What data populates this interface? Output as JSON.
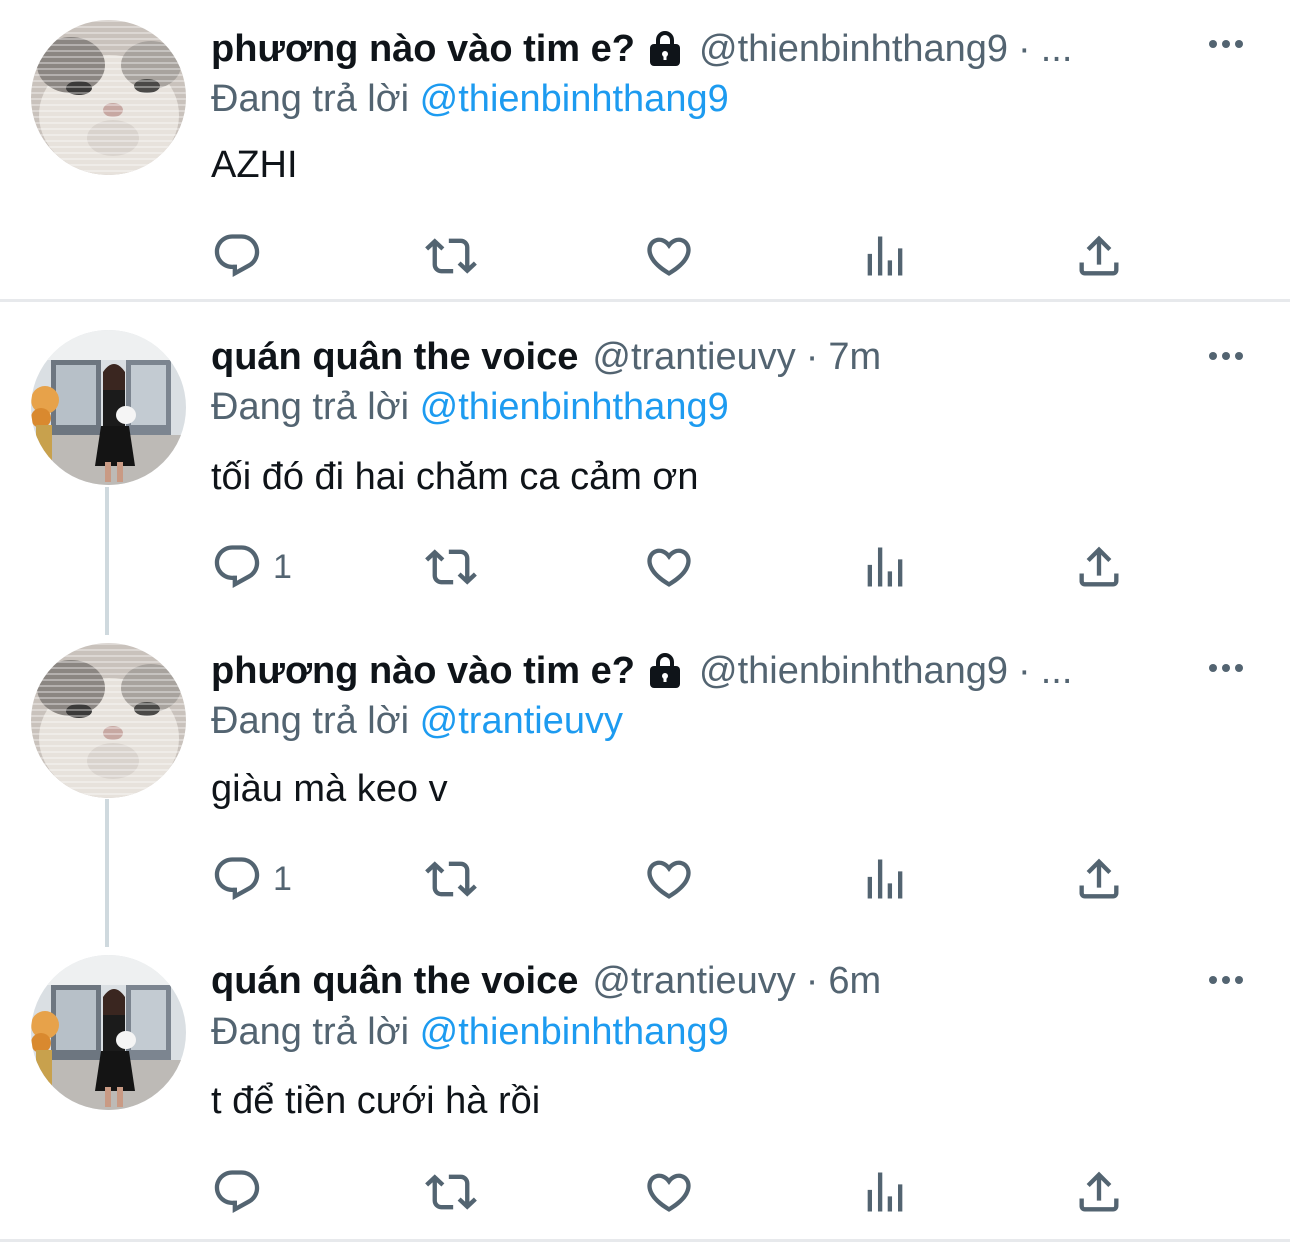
{
  "tweets": [
    {
      "name": "phương nào vào tim e?",
      "locked": true,
      "handle": "@thienbinhthang9",
      "separator": "·",
      "time": "...",
      "reply_prefix": "Đang trả lời",
      "reply_to": "@thienbinhthang9",
      "text": "AZHI",
      "reply_count": "",
      "avatar": "cat-avatar"
    },
    {
      "name": "quán quân the voice",
      "locked": false,
      "handle": "@trantieuvy",
      "separator": "·",
      "time": "7m",
      "reply_prefix": "Đang trả lời",
      "reply_to": "@thienbinhthang9",
      "text": "tối đó đi hai chăm ca cảm ơn",
      "reply_count": "1",
      "avatar": "woman-avatar"
    },
    {
      "name": "phương nào vào tim e?",
      "locked": true,
      "handle": "@thienbinhthang9",
      "separator": "·",
      "time": "...",
      "reply_prefix": "Đang trả lời",
      "reply_to": "@trantieuvy",
      "text": "giàu mà keo v",
      "reply_count": "1",
      "avatar": "cat-avatar"
    },
    {
      "name": "quán quân the voice",
      "locked": false,
      "handle": "@trantieuvy",
      "separator": "·",
      "time": "6m",
      "reply_prefix": "Đang trả lời",
      "reply_to": "@thienbinhthang9",
      "text": "t để tiền cưới hà rồi",
      "reply_count": "",
      "avatar": "woman-avatar"
    }
  ],
  "icons": {
    "reply": "reply-icon",
    "retweet": "retweet-icon",
    "like": "heart-icon",
    "views": "views-icon",
    "share": "share-icon",
    "more": "more-icon",
    "lock": "lock-icon"
  },
  "colors": {
    "text": "#0f1419",
    "secondary": "#536471",
    "link": "#1d9bf0",
    "divider": "#e7e9ec",
    "thread_line": "#cfd9de"
  }
}
